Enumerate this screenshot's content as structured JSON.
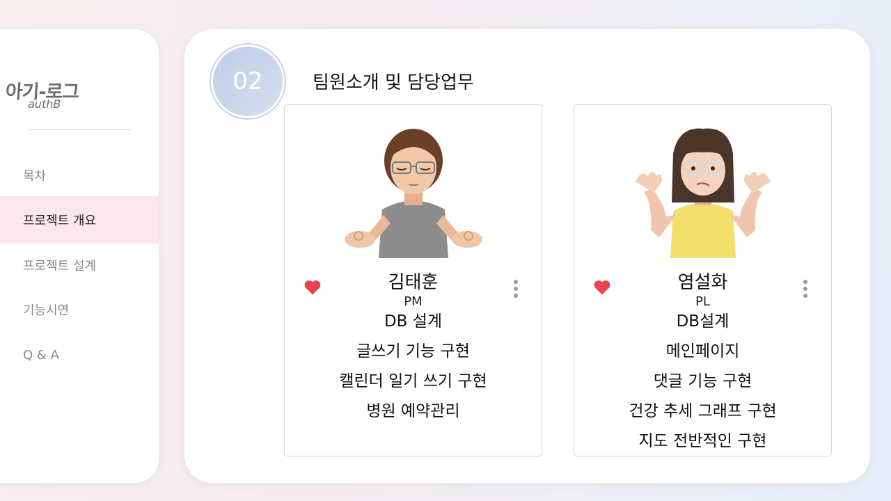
{
  "sidebar": {
    "logo_main": "아기-로그",
    "logo_sub": "authB",
    "items": [
      {
        "label": "목차",
        "active": false
      },
      {
        "label": "프로젝트 개요",
        "active": true
      },
      {
        "label": "프로젝트 설계",
        "active": false
      },
      {
        "label": "기능시연",
        "active": false
      },
      {
        "label": "Q & A",
        "active": false
      }
    ]
  },
  "main": {
    "badge_number": "02",
    "section_title": "팀원소개 및 담당업무",
    "members": [
      {
        "name": "김태훈",
        "role": "PM",
        "avatar": "memoji-man-meditating-icon",
        "duties": [
          "DB 설계",
          "글쓰기 기능 구현",
          "캘린더 일기 쓰기 구현",
          "병원 예약관리"
        ]
      },
      {
        "name": "염설화",
        "role": "PL",
        "avatar": "memoji-woman-shrugging-icon",
        "duties": [
          "DB설계",
          "메인페이지",
          "댓글 기능 구현",
          "건강 추세 그래프 구현",
          "지도 전반적인 구현"
        ]
      }
    ]
  },
  "colors": {
    "active_nav_bg": "#fde7ee",
    "badge_gradient": "#c0cde8",
    "heart": "#e8434f"
  }
}
